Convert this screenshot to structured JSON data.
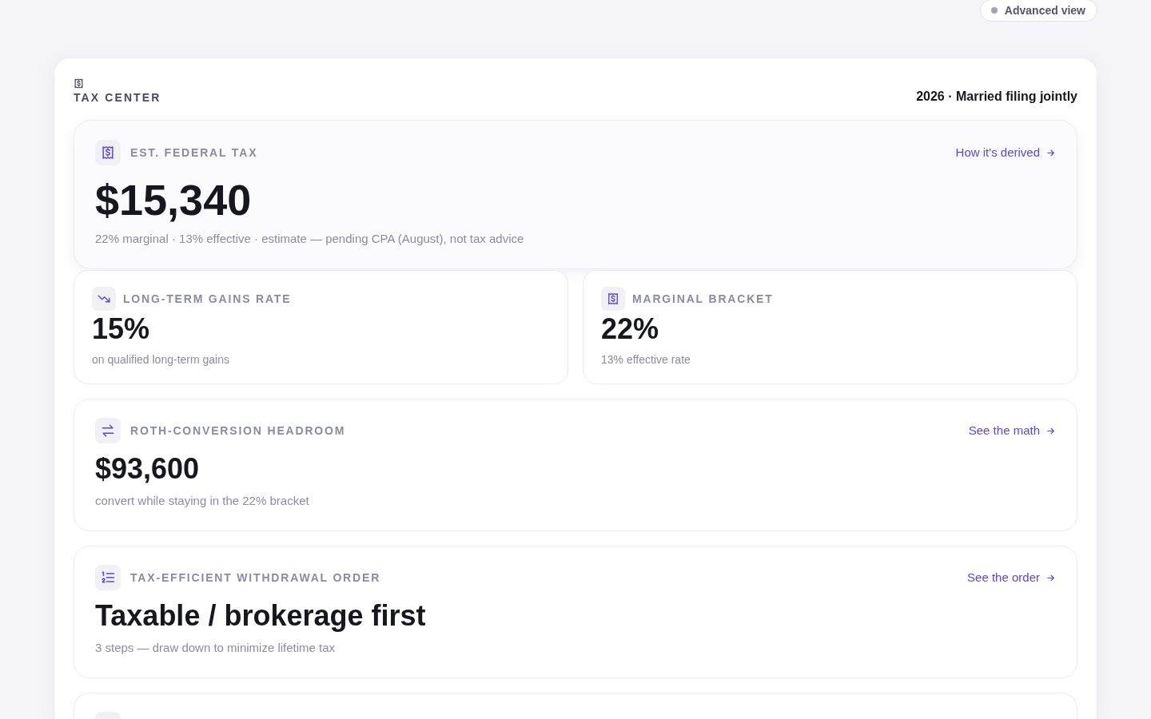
{
  "advanced_view": {
    "label": "Advanced view",
    "on": false
  },
  "panel": {
    "title": "TAX CENTER",
    "context": "2026 · Married filing jointly"
  },
  "cards": [
    {
      "kind": "hero",
      "label": "EST. FEDERAL TAX",
      "value": "$15,340",
      "note": "22% marginal · 13% effective · estimate — pending CPA (August), not tax advice",
      "link": "How it's derived"
    },
    {
      "kind": "pair",
      "items": [
        {
          "label": "LONG-TERM GAINS RATE",
          "value": "15%",
          "note": "on qualified long-term gains"
        },
        {
          "label": "MARGINAL BRACKET",
          "value": "22%",
          "note": "13% effective rate"
        }
      ]
    },
    {
      "kind": "metric",
      "label": "ROTH-CONVERSION HEADROOM",
      "value": "$93,600",
      "note": "convert while staying in the 22% bracket",
      "link": "See the math"
    },
    {
      "kind": "metric",
      "label": "TAX-EFFICIENT WITHDRAWAL ORDER",
      "value": "Taxable / brokerage first",
      "note": "3 steps — draw down to minimize lifetime tax",
      "link": "See the order"
    }
  ]
}
